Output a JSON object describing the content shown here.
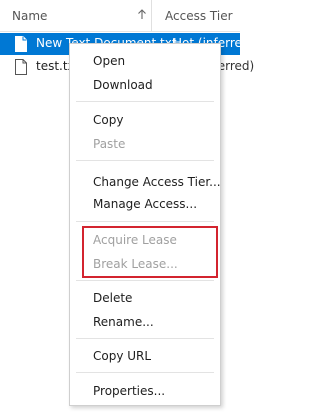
{
  "header": {
    "name_label": "Name",
    "access_tier_label": "Access Tier"
  },
  "files": [
    {
      "name": "New Text Document.txt",
      "tier": "Hot (inferred)",
      "selected": true
    },
    {
      "name": "test.txt",
      "tier": "Hot (inferred)",
      "selected": false
    }
  ],
  "context_menu": {
    "open": "Open",
    "download": "Download",
    "copy": "Copy",
    "paste": "Paste",
    "change_access_tier": "Change Access Tier...",
    "manage_access": "Manage Access...",
    "acquire_lease": "Acquire Lease",
    "break_lease": "Break Lease...",
    "delete": "Delete",
    "rename": "Rename...",
    "copy_url": "Copy URL",
    "properties": "Properties..."
  },
  "colors": {
    "selection": "#0078d4",
    "highlight_box": "#d3242f",
    "disabled_text": "#a0a0a0"
  }
}
